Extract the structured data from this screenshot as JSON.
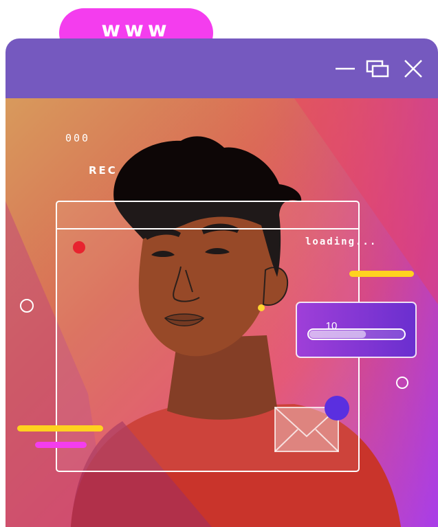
{
  "url_tab": {
    "label": "www"
  },
  "window": {
    "controls": [
      "minimize-icon",
      "restore-icon",
      "close-icon"
    ],
    "colors": {
      "titlebar": "#7559bf",
      "tab": "#f43dee"
    }
  },
  "recorder": {
    "menu_dots": "000",
    "rec_label": "REC",
    "rec_color": "#e8232f"
  },
  "loading": {
    "label": "loading...",
    "progress": 0.6
  },
  "mail": {
    "unread_count": "10",
    "icon": "envelope-icon"
  }
}
